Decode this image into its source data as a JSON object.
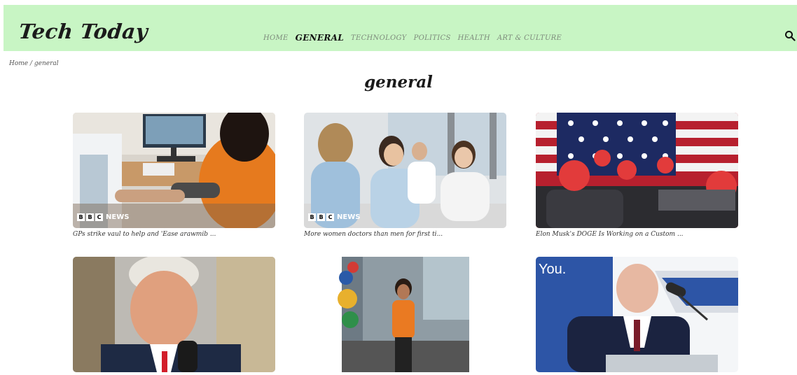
{
  "header": {
    "logo": "Tech Today",
    "nav": [
      "HOME",
      "GENERAL",
      "TECHNOLOGY",
      "POLITICS",
      "HEALTH",
      "ART & CULTURE"
    ],
    "active_nav": "GENERAL",
    "background": "#c8f5c4"
  },
  "breadcrumb": "Home / general",
  "page_title": "general",
  "articles": [
    {
      "caption": "GPs strike vaul to help and 'Ease arawmib ...",
      "image": "blood-pressure-check-photo",
      "badge": "BBC NEWS"
    },
    {
      "caption": "More women doctors than men for first ti...",
      "image": "nurses-group-photo",
      "badge": "BBC NEWS"
    },
    {
      "caption": "Elon Musk's DOGE Is Working on a Custom ...",
      "image": "flag-blurred-people-photo"
    },
    {
      "caption": "",
      "image": "man-speaking-photo"
    },
    {
      "caption": "",
      "image": "woman-office-photo"
    },
    {
      "caption": "",
      "image": "man-at-podium-photo"
    }
  ]
}
